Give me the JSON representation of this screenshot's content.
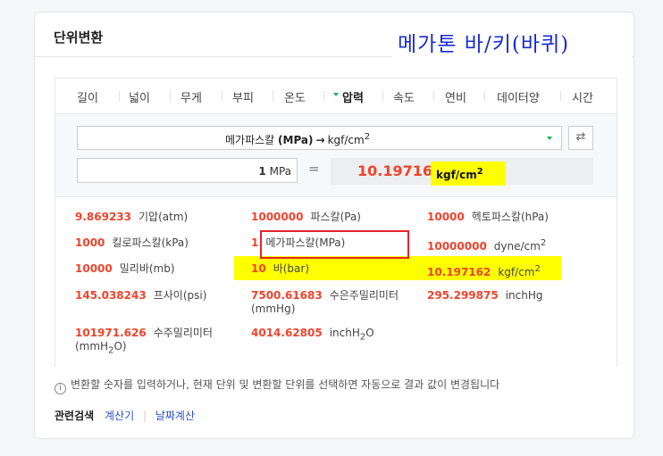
{
  "card_title": "단위변환",
  "overlay_title": "메가톤 바/키(바퀴)",
  "tabs": [
    "길이",
    "넓이",
    "무게",
    "부피",
    "온도",
    "압력",
    "속도",
    "연비",
    "데이터양",
    "시간"
  ],
  "active_tab": "압력",
  "converter": {
    "from_unit": "메가파스칼",
    "from_abbr": "(MPa)",
    "to_unit": "kgf/cm",
    "to_sup": "2",
    "input_value": "1",
    "input_unit": "MPa",
    "equals": "=",
    "result_value": "10.197162",
    "result_unit": "kgf/cm",
    "result_sup": "2",
    "swap_icon": "⇄"
  },
  "results": [
    {
      "num": "9.869233",
      "unit": "기압(atm)"
    },
    {
      "num": "1000000",
      "unit": "파스칼(Pa)"
    },
    {
      "num": "10000",
      "unit": "헥토파스칼(hPa)"
    },
    {
      "num": "1000",
      "unit": "킬로파스칼(kPa)"
    },
    {
      "num": "1",
      "unit": "메가파스칼(MPa)"
    },
    {
      "num": "10000000",
      "unit": "dyne/cm",
      "sup": "2"
    },
    {
      "num": "10000",
      "unit": "밀리바(mb)"
    },
    {
      "num": "10",
      "unit": "바(bar)"
    },
    {
      "num": "10.197162",
      "unit": "kgf/cm",
      "sup": "2"
    },
    {
      "num": "145.038243",
      "unit": "프사이(psi)"
    },
    {
      "num": "7500.61683",
      "unit": "수은주밀리미터 (mmHg)"
    },
    {
      "num": "295.299875",
      "unit": "inchHg"
    },
    {
      "num": "101971.626",
      "unit": "수주밀리미터 (mmH",
      "sub": "2",
      "unit_tail": "O)"
    },
    {
      "num": "4014.62805",
      "unit": "inchH",
      "sub": "2",
      "unit_tail": "O"
    }
  ],
  "info_text": "변환할 숫자를 입력하거나, 현재 단위 및 변환할 단위를 선택하면 자동으로 결과 값이 변경됩니다",
  "info_icon": "i",
  "related": {
    "label": "관련검색",
    "links": [
      "계산기",
      "날짜계산"
    ],
    "sep": "|"
  },
  "highlight_color": "#ffff00",
  "accent_red": "#f0432b",
  "overlay_blue": "#1a2bd6"
}
